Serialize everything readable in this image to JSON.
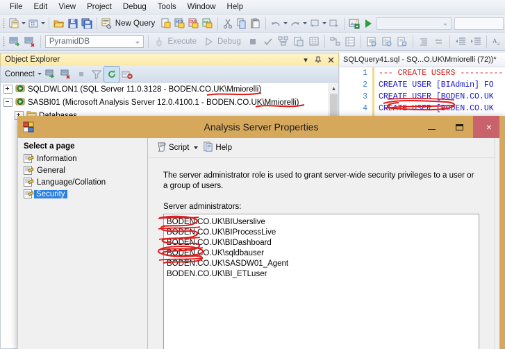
{
  "menu": {
    "items": [
      "File",
      "Edit",
      "View",
      "Project",
      "Debug",
      "Tools",
      "Window",
      "Help"
    ]
  },
  "toolbar_main": {
    "new_query_label": "New Query",
    "icons": [
      "new-project-icon",
      "new-item-icon",
      "open-file-icon",
      "save-icon",
      "save-all-icon",
      "new-query-icon",
      "new-analysis-query-icon",
      "new-mdx-query-icon",
      "new-dmx-query-icon",
      "new-xmla-query-icon",
      "cut-icon",
      "copy-icon",
      "paste-icon",
      "undo-icon",
      "redo-icon",
      "navigate-backward-icon",
      "navigate-forward-icon",
      "object-explorer-icon",
      "run-icon"
    ]
  },
  "toolbar_query": {
    "database_value": "PyramidDB",
    "execute_label": "Execute",
    "debug_label": "Debug",
    "icons": [
      "connect-icon",
      "disconnect-icon",
      "parse-icon",
      "check-icon",
      "display-estimated-plan-icon",
      "query-options-icon",
      "include-actual-plan-icon",
      "include-client-stats-icon",
      "results-to-text-icon",
      "results-to-grid-icon",
      "results-to-file-icon",
      "comment-icon",
      "uncomment-icon",
      "decrease-indent-icon",
      "increase-indent-icon",
      "font-icon"
    ]
  },
  "object_explorer": {
    "title": "Object Explorer",
    "connect_label": "Connect",
    "titlebar_icons": [
      "chevron-down-icon",
      "pin-icon",
      "close-icon"
    ],
    "toolbar_icons": [
      "connect-server-icon",
      "disconnect-server-icon",
      "stop-icon",
      "filter-icon",
      "refresh-icon",
      "sync-icon"
    ],
    "tree": [
      {
        "label": "SQLDWLON1 (SQL Server 11.0.3128 - BODEN.CO.UK\\Mmiorelli)",
        "expander": "plus",
        "indent": 0,
        "icon": "server-icon"
      },
      {
        "label": "SASBI01 (Microsoft Analysis Server 12.0.4100.1 - BODEN.CO.UK\\Mmiorelli)",
        "expander": "minus",
        "indent": 0,
        "icon": "analysis-server-icon"
      },
      {
        "label": "Databases",
        "expander": "plus",
        "indent": 1,
        "icon": "folder-icon"
      }
    ]
  },
  "query_editor": {
    "tab_title": "SQLQuery41.sql - SQ...O.UK\\Mmiorelli (72))*",
    "lines": [
      {
        "num": "1",
        "text": "--- CREATE USERS ---------",
        "type": "comment"
      },
      {
        "num": "2",
        "text": "CREATE USER [BIAdmin] FO",
        "type": "code"
      },
      {
        "num": "3",
        "text": "CREATE USER [BODEN.CO.UK",
        "type": "code"
      },
      {
        "num": "4",
        "text": "CREATE USER [BODEN.CO.UK",
        "type": "code"
      }
    ]
  },
  "dialog": {
    "title": "Analysis Server Properties",
    "icon": "properties-icon",
    "window_buttons": {
      "minimize": "minimize-icon",
      "maximize": "maximize-icon",
      "close": "×"
    },
    "select_page_header": "Select a page",
    "pages": [
      {
        "label": "Information",
        "selected": false
      },
      {
        "label": "General",
        "selected": false
      },
      {
        "label": "Language/Collation",
        "selected": false
      },
      {
        "label": "Security",
        "selected": true
      }
    ],
    "toolbar": {
      "script_label": "Script",
      "help_label": "Help",
      "script_icon": "script-icon",
      "help_icon": "help-icon"
    },
    "description": "The server administrator role is used to grant server-wide security privileges to a user or a group of users.",
    "administrators_label": "Server administrators:",
    "administrators": [
      "BODEN.CO.UK\\BIUserslive",
      "BODEN.CO.UK\\BIProcessLive",
      "BODEN.CO.UK\\BIDashboard",
      "BODEN.CO.UK\\sqldbauser",
      "BODEN.CO.UK\\SASDW01_Agent",
      "BODEN.CO.UK\\BI_ETLuser"
    ]
  },
  "colors": {
    "dialog_titlebar": "#d6a85c",
    "close_button": "#c9636b",
    "selection_blue": "#2a7fe0",
    "panel_title_yellow": "#fbe9a5",
    "redaction_red": "#e01b1b",
    "sql_keyword": "#1515cf",
    "sql_comment": "#d01a1a",
    "line_number": "#3f7fd0"
  }
}
